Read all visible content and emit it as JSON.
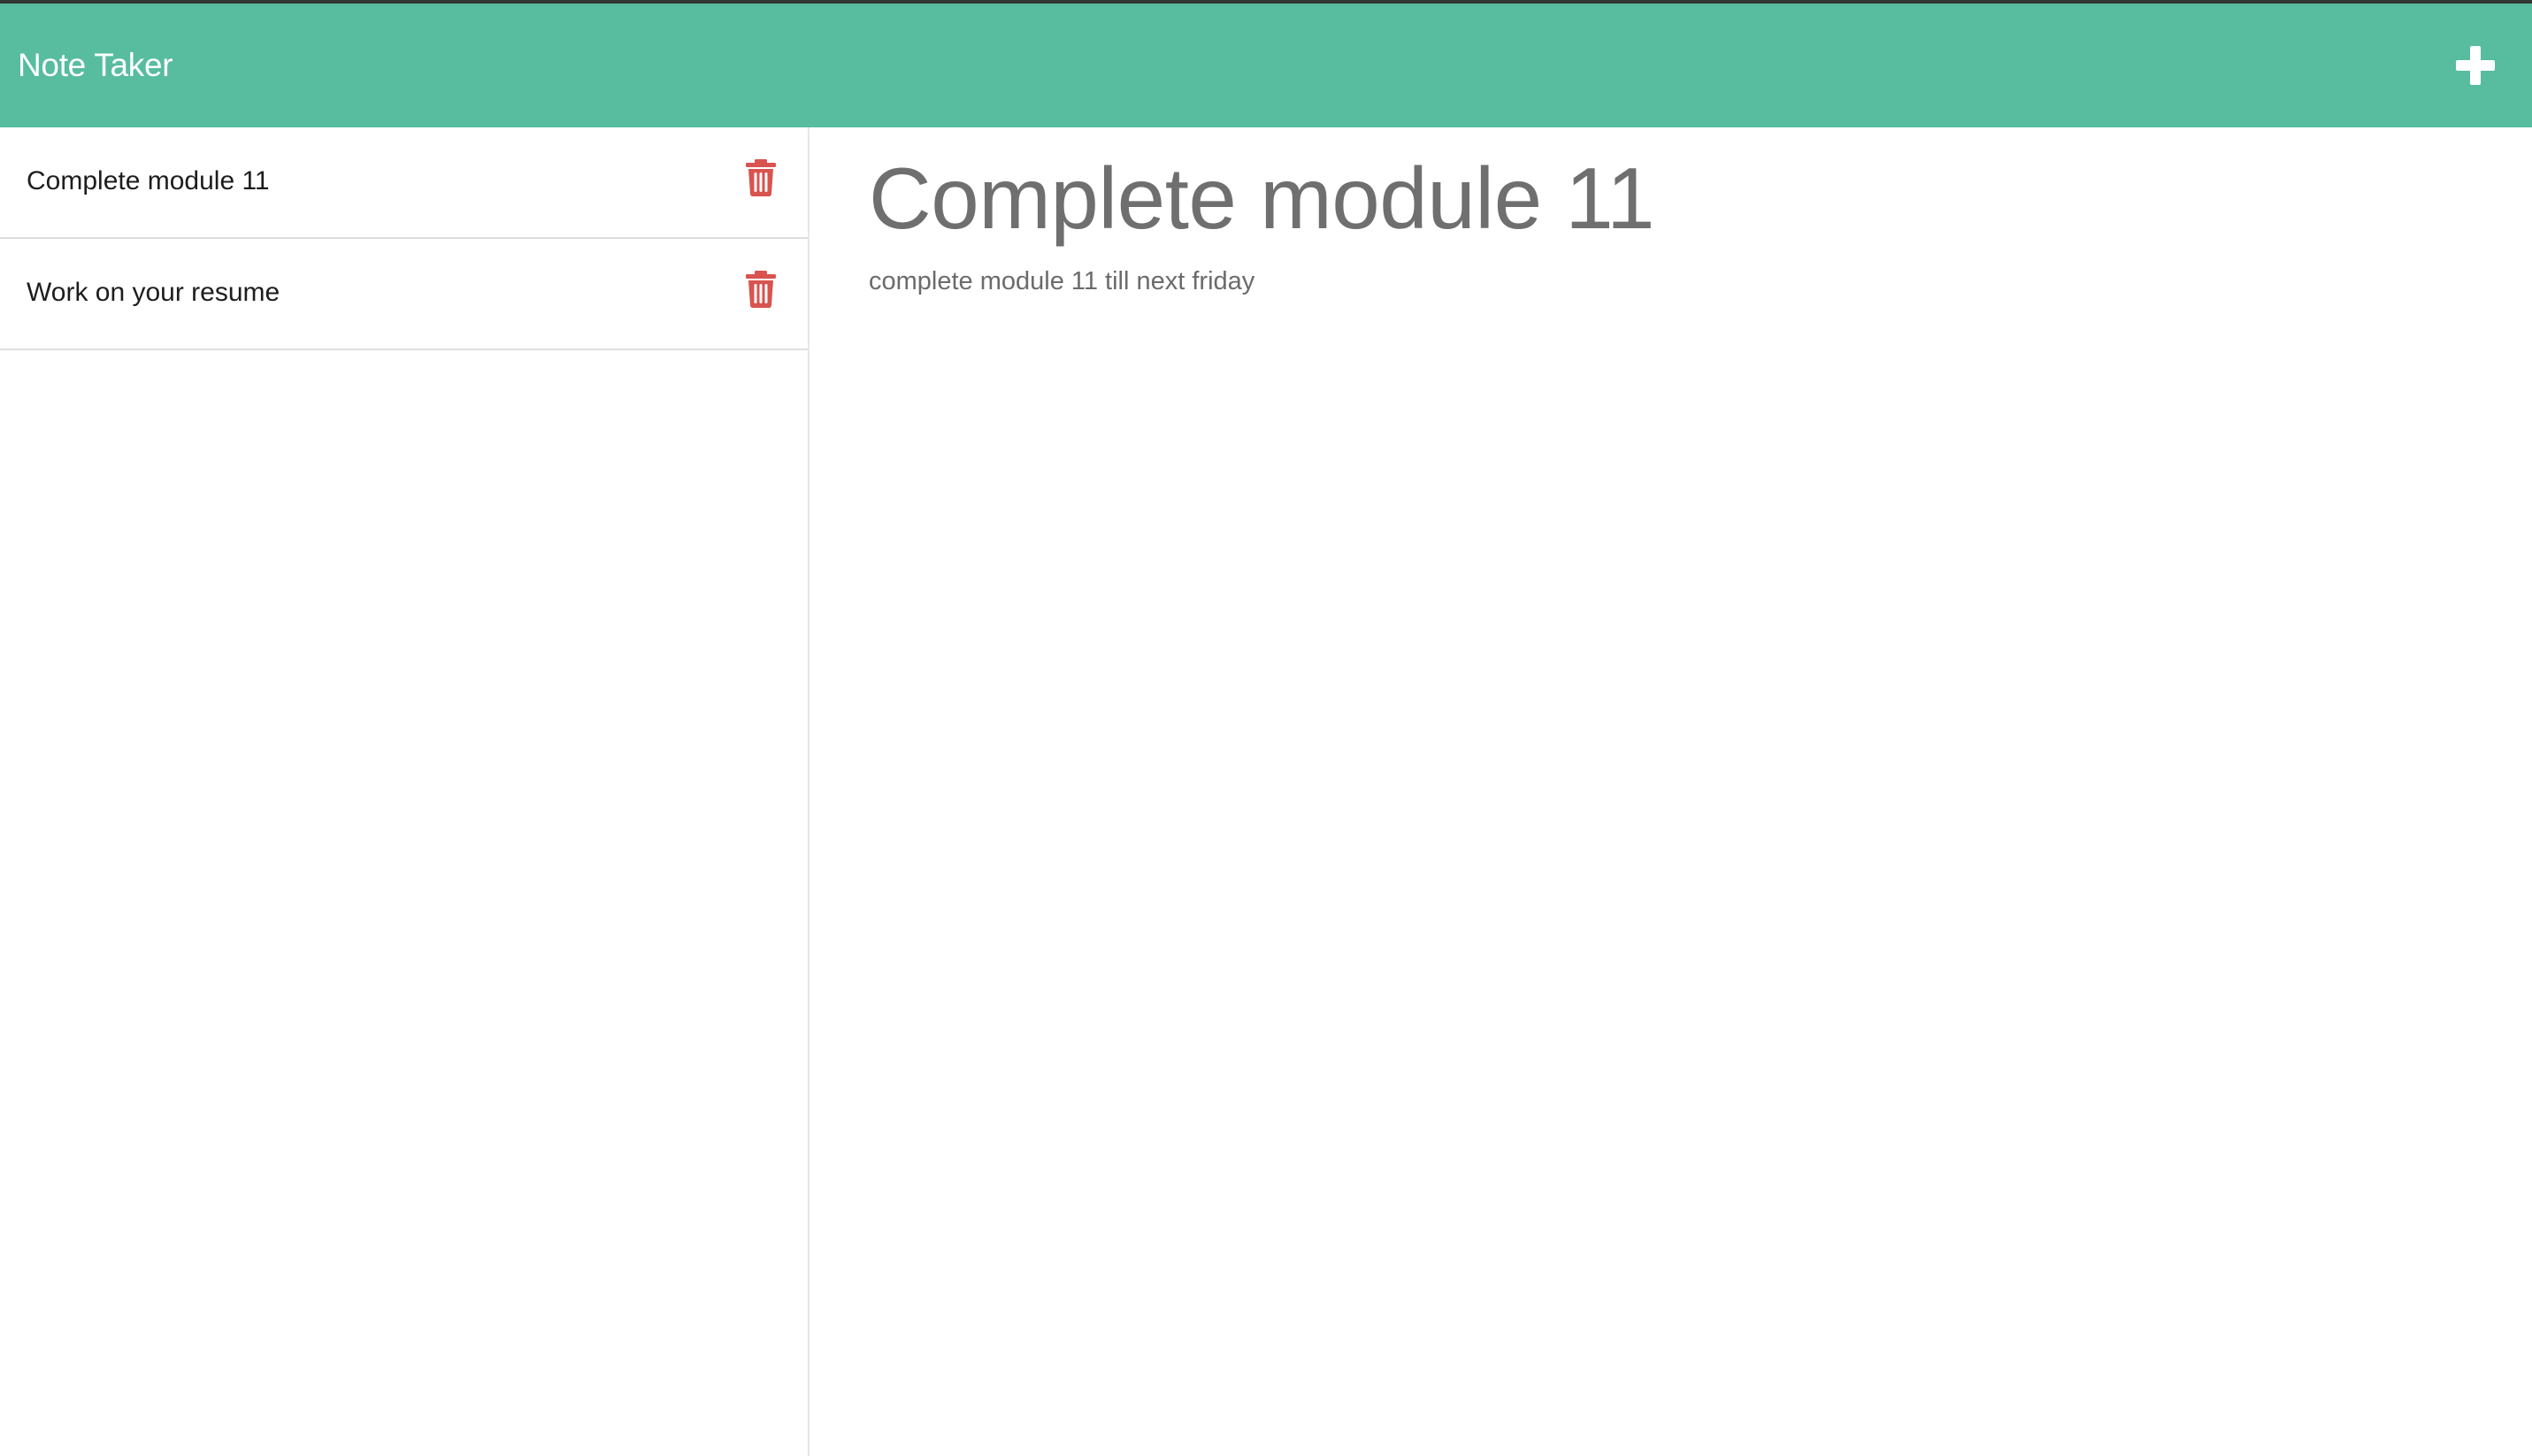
{
  "app": {
    "title": "Note Taker"
  },
  "header": {
    "add_icon": "plus-icon"
  },
  "sidebar": {
    "notes": [
      {
        "title": "Complete module 11",
        "delete_icon": "trash-icon"
      },
      {
        "title": "Work on your resume",
        "delete_icon": "trash-icon"
      }
    ]
  },
  "main": {
    "note_title": "Complete module 11",
    "note_text": "complete module 11 till next friday"
  },
  "colors": {
    "navbar": "#58bc9f",
    "delete": "#d9534f",
    "heading_text": "#6f6f6f"
  }
}
